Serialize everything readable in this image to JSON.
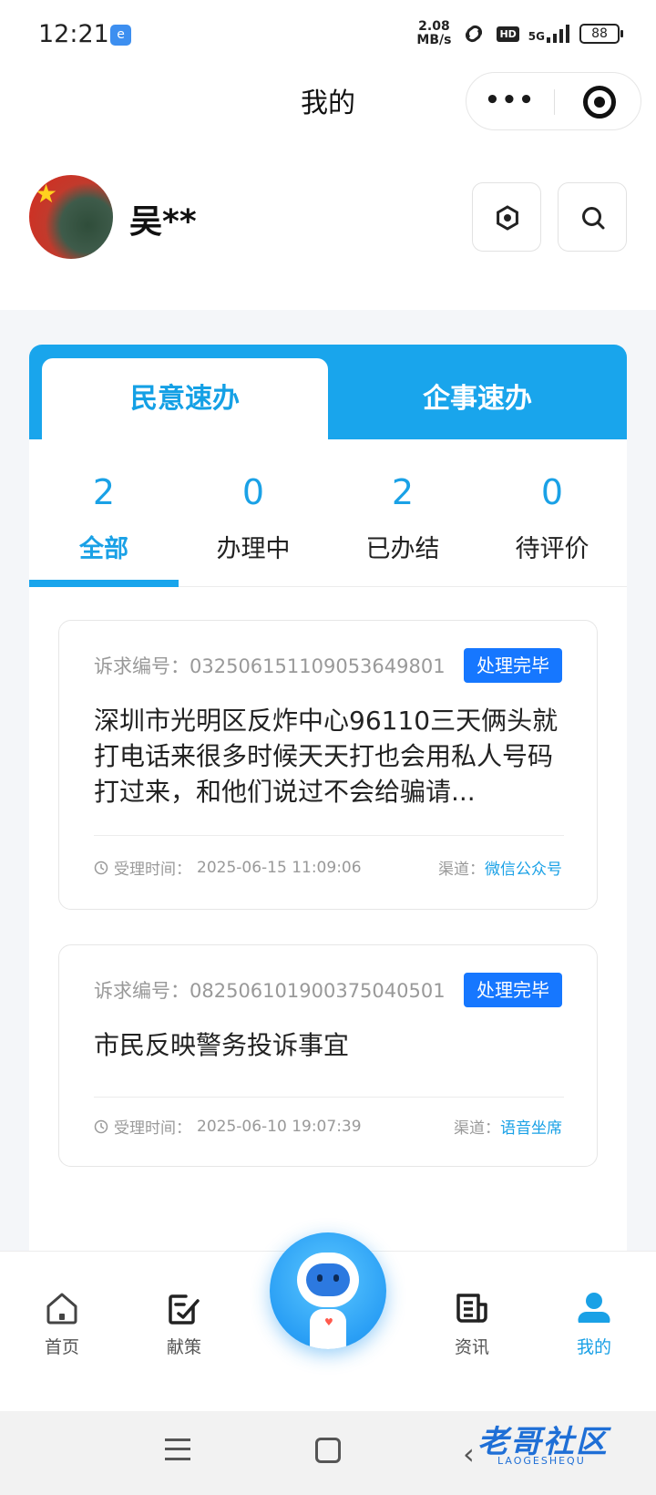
{
  "status_bar": {
    "time": "12:21",
    "net_speed_value": "2.08",
    "net_speed_unit": "MB/s",
    "hd": "HD",
    "network": "5G",
    "battery": "88"
  },
  "header": {
    "title": "我的",
    "more_label": "•••"
  },
  "user": {
    "name": "吴**"
  },
  "card_tabs": [
    {
      "label": "民意速办"
    },
    {
      "label": "企事速办"
    }
  ],
  "stats": [
    {
      "count": "2",
      "label": "全部"
    },
    {
      "count": "0",
      "label": "办理中"
    },
    {
      "count": "2",
      "label": "已办结"
    },
    {
      "count": "0",
      "label": "待评价"
    }
  ],
  "appeals": [
    {
      "number_label": "诉求编号：",
      "number": "032506151109053649801",
      "status": "处理完毕",
      "description": "深圳市光明区反炸中心96110三天俩头就打电话来很多时候天天打也会用私人号码打过来，和他们说过不会给骗请...",
      "time_label": "受理时间：",
      "time": "2025-06-15 11:09:06",
      "channel_label": "渠道：",
      "channel": "微信公众号"
    },
    {
      "number_label": "诉求编号：",
      "number": "082506101900375040501",
      "status": "处理完毕",
      "description": "市民反映警务投诉事宜",
      "time_label": "受理时间：",
      "time": "2025-06-10 19:07:39",
      "channel_label": "渠道：",
      "channel": "语音坐席"
    }
  ],
  "bottom_nav": [
    {
      "label": "首页",
      "icon": "home-icon"
    },
    {
      "label": "献策",
      "icon": "edit-icon"
    },
    {
      "label": "资讯",
      "icon": "news-icon"
    },
    {
      "label": "我的",
      "icon": "user-icon"
    }
  ],
  "watermark": {
    "text": "老哥社区",
    "sub": "LAOGESHEQU"
  },
  "colors": {
    "accent": "#19a5ec",
    "badge": "#1677ff",
    "page_bg": "#f4f6f9"
  }
}
